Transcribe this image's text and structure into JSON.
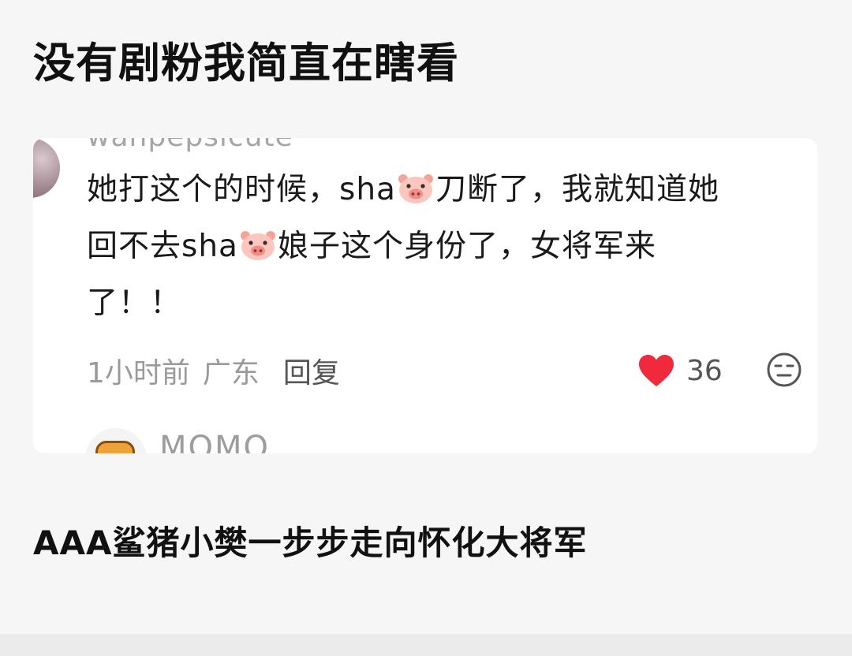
{
  "post": {
    "title": "没有剧粉我简直在瞎看",
    "caption": "AAA鲨猪小樊一步步走向怀化大将军"
  },
  "comment": {
    "username": "wanpepsicute",
    "lines": [
      [
        "她打这个的时候，sha",
        "刀断了，我就知道她"
      ],
      [
        "回不去sha",
        "娘子这个身份了，女将军来"
      ],
      [
        "了！！"
      ]
    ],
    "time": "1小时前",
    "location": "广东",
    "reply_label": "回复",
    "like_count": "36",
    "like_color": "#f02a3c"
  },
  "next_comment": {
    "username": "MOMO"
  },
  "icons": {
    "pig": "pig-face-emoji",
    "like": "heart-icon",
    "react": "neutral-face-icon"
  }
}
